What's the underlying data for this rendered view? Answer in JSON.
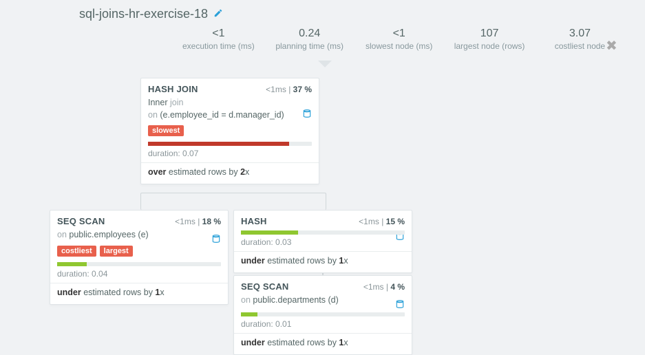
{
  "title": "sql-joins-hr-exercise-18",
  "summary": {
    "exec": {
      "value": "<1",
      "label": "execution time (ms)"
    },
    "plan": {
      "value": "0.24",
      "label": "planning time (ms)"
    },
    "slowest": {
      "value": "<1",
      "label": "slowest node (ms)"
    },
    "largest": {
      "value": "107",
      "label": "largest node (rows)"
    },
    "costliest": {
      "value": "3.07",
      "label": "costliest node"
    }
  },
  "nodes": {
    "hashjoin": {
      "name": "HASH JOIN",
      "meta_time": "<1ms",
      "meta_pct": "37 %",
      "sub1_kw": "Inner",
      "sub1_rest": " join",
      "sub2_kw": "on",
      "sub2_rest": " (e.employee_id = d.manager_id)",
      "badge": "slowest",
      "duration": "duration: 0.07",
      "est_pre": "over",
      "est_mid": " estimated rows by ",
      "est_x": "2",
      "est_suf": "x"
    },
    "seqscan_emp": {
      "name": "SEQ SCAN",
      "meta_time": "<1ms",
      "meta_pct": "18 %",
      "sub_kw": "on",
      "sub_rest": " public.employees (e)",
      "badge1": "costliest",
      "badge2": "largest",
      "duration": "duration: 0.04",
      "est_pre": "under",
      "est_mid": " estimated rows by ",
      "est_x": "1",
      "est_suf": "x"
    },
    "hash": {
      "name": "HASH",
      "meta_time": "<1ms",
      "meta_pct": "15 %",
      "duration": "duration: 0.03",
      "est_pre": "under",
      "est_mid": " estimated rows by ",
      "est_x": "1",
      "est_suf": "x"
    },
    "seqscan_dep": {
      "name": "SEQ SCAN",
      "meta_time": "<1ms",
      "meta_pct": "4 %",
      "sub_kw": "on",
      "sub_rest": " public.departments (d)",
      "duration": "duration: 0.01",
      "est_pre": "under",
      "est_mid": " estimated rows by ",
      "est_x": "1",
      "est_suf": "x"
    }
  }
}
